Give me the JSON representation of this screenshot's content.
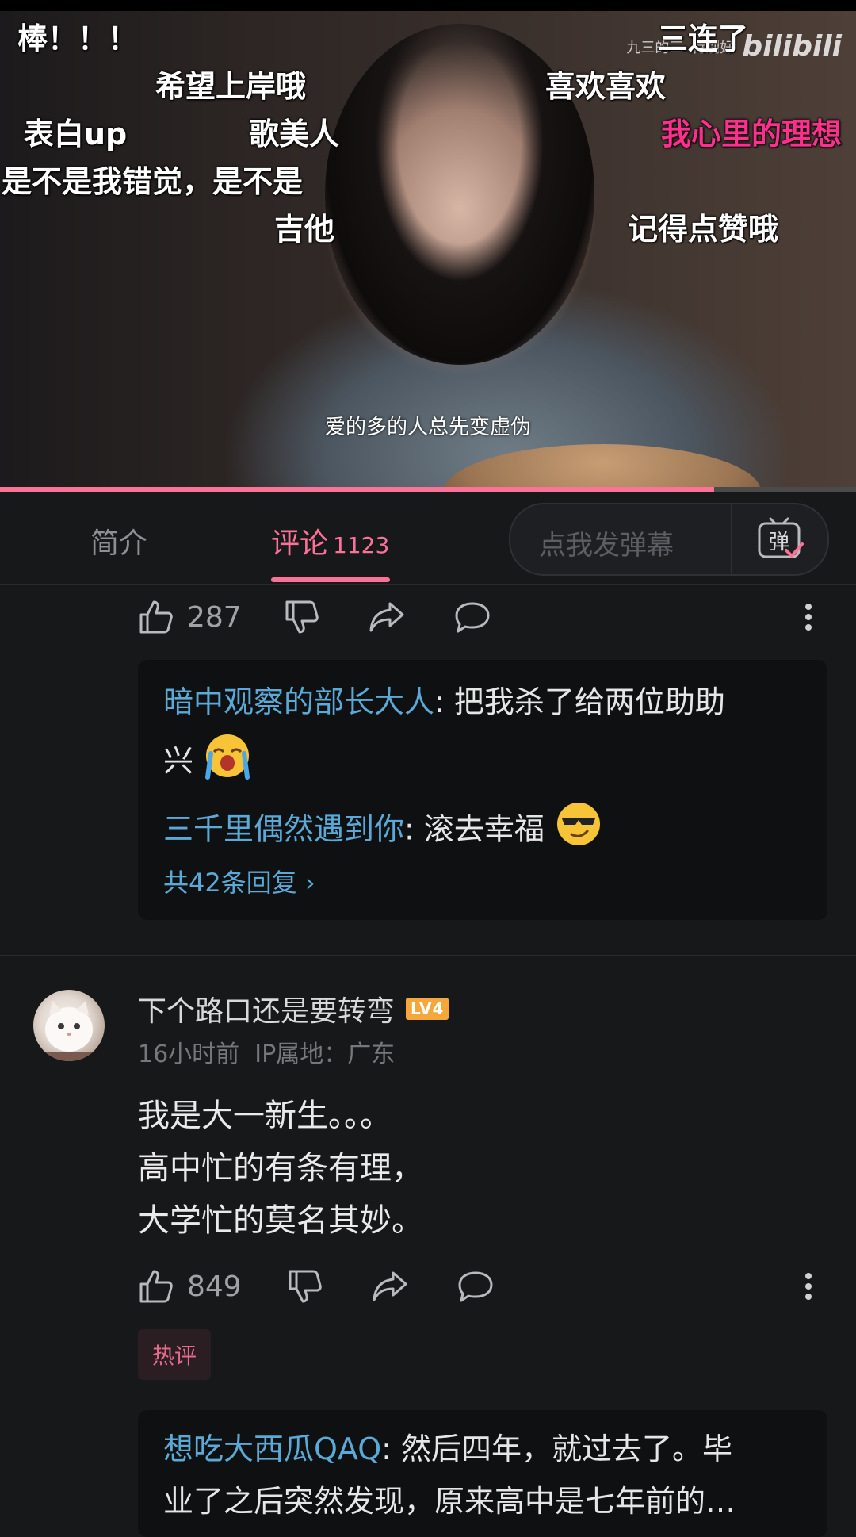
{
  "video": {
    "danmaku": [
      {
        "text": "棒！！！",
        "color": "#ffffff"
      },
      {
        "text": "三连了",
        "color": "#ffffff"
      },
      {
        "text": "希望上岸哦",
        "color": "#ffffff"
      },
      {
        "text": "喜欢喜欢",
        "color": "#ffffff"
      },
      {
        "text": "表白up",
        "color": "#ffffff"
      },
      {
        "text": "歌美人",
        "color": "#ffffff"
      },
      {
        "text": "我心里的理想",
        "color": "#ff2f8e"
      },
      {
        "text": "是不是我错觉，是不是",
        "color": "#ffffff"
      },
      {
        "text": "吉他",
        "color": "#ffffff"
      },
      {
        "text": "记得点赞哦",
        "color": "#ffffff"
      }
    ],
    "watermark": "九三的三",
    "watermark2": "特别好",
    "platform_logo": "bilibili",
    "subtitle": "爱的多的人总先变虚伪",
    "progress": 0.834
  },
  "tabs": {
    "intro": "简介",
    "comments": "评论",
    "comment_count": "1123",
    "danmaku_placeholder": "点我发弹幕",
    "danmaku_toggle_label": "弹"
  },
  "comments": [
    {
      "likes": "287",
      "replies": [
        {
          "user": "暗中观察的部长大人",
          "sep": ": ",
          "text1": "把我杀了给两位助助",
          "text2": "兴"
        },
        {
          "user": "三千里偶然遇到你",
          "sep": ": ",
          "text1": "滚去幸福"
        }
      ],
      "more_replies": "共42条回复 ›"
    },
    {
      "username": "下个路口还是要转弯",
      "level": "LV4",
      "time": "16小时前",
      "ip": "IP属地：广东",
      "text": "我是大一新生。。。\n高中忙的有条有理，\n大学忙的莫名其妙。",
      "likes": "849",
      "tag": "热评",
      "replies": [
        {
          "user": "想吃大西瓜QAQ",
          "sep": ": ",
          "text1": "然后四年，就过去了。毕",
          "text2": "业了之后突然发现，原来高中是七年前的…"
        }
      ]
    }
  ],
  "colors": {
    "accent": "#fb7299",
    "username_link": "#5aa9d6",
    "background": "#17181a"
  }
}
